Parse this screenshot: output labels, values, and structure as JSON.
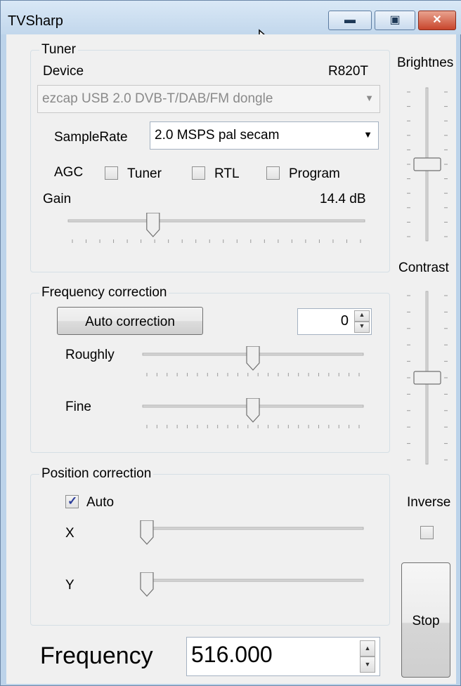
{
  "window": {
    "title": "TVSharp"
  },
  "tuner": {
    "legend": "Tuner",
    "device_label": "Device",
    "device_model": "R820T",
    "device_combo": "ezcap USB 2.0 DVB-T/DAB/FM dongle",
    "samplerate_label": "SampleRate",
    "samplerate_value": "2.0 MSPS pal secam",
    "agc_label": "AGC",
    "agc_tuner": "Tuner",
    "agc_rtl": "RTL",
    "agc_program": "Program",
    "agc_tuner_checked": false,
    "agc_rtl_checked": false,
    "agc_program_checked": false,
    "gain_label": "Gain",
    "gain_value": "14.4 dB",
    "gain_slider_fraction": 0.28
  },
  "freq_correction": {
    "legend": "Frequency correction",
    "auto_button": "Auto correction",
    "spin_value": "0",
    "roughly_label": "Roughly",
    "roughly_fraction": 0.5,
    "fine_label": "Fine",
    "fine_fraction": 0.5
  },
  "position_correction": {
    "legend": "Position correction",
    "auto_label": "Auto",
    "auto_checked": true,
    "x_label": "X",
    "x_fraction": 0.0,
    "y_label": "Y",
    "y_fraction": 0.0
  },
  "side": {
    "brightness_label": "Brightnes",
    "brightness_fraction": 0.5,
    "contrast_label": "Contrast",
    "contrast_fraction": 0.5,
    "inverse_label": "Inverse",
    "inverse_checked": false,
    "stop_button": "Stop"
  },
  "frequency": {
    "label": "Frequency",
    "value": "516.000"
  },
  "icons": {
    "minimize": "minimize-icon",
    "maximize": "maximize-icon",
    "close": "close-icon",
    "dropdown": "chevron-down-icon",
    "cursor": "mouse-pointer-icon"
  },
  "colors": {
    "titlebar": "#c2d7ec",
    "close_button": "#c8452c",
    "check_mark": "#2c3d9a"
  }
}
